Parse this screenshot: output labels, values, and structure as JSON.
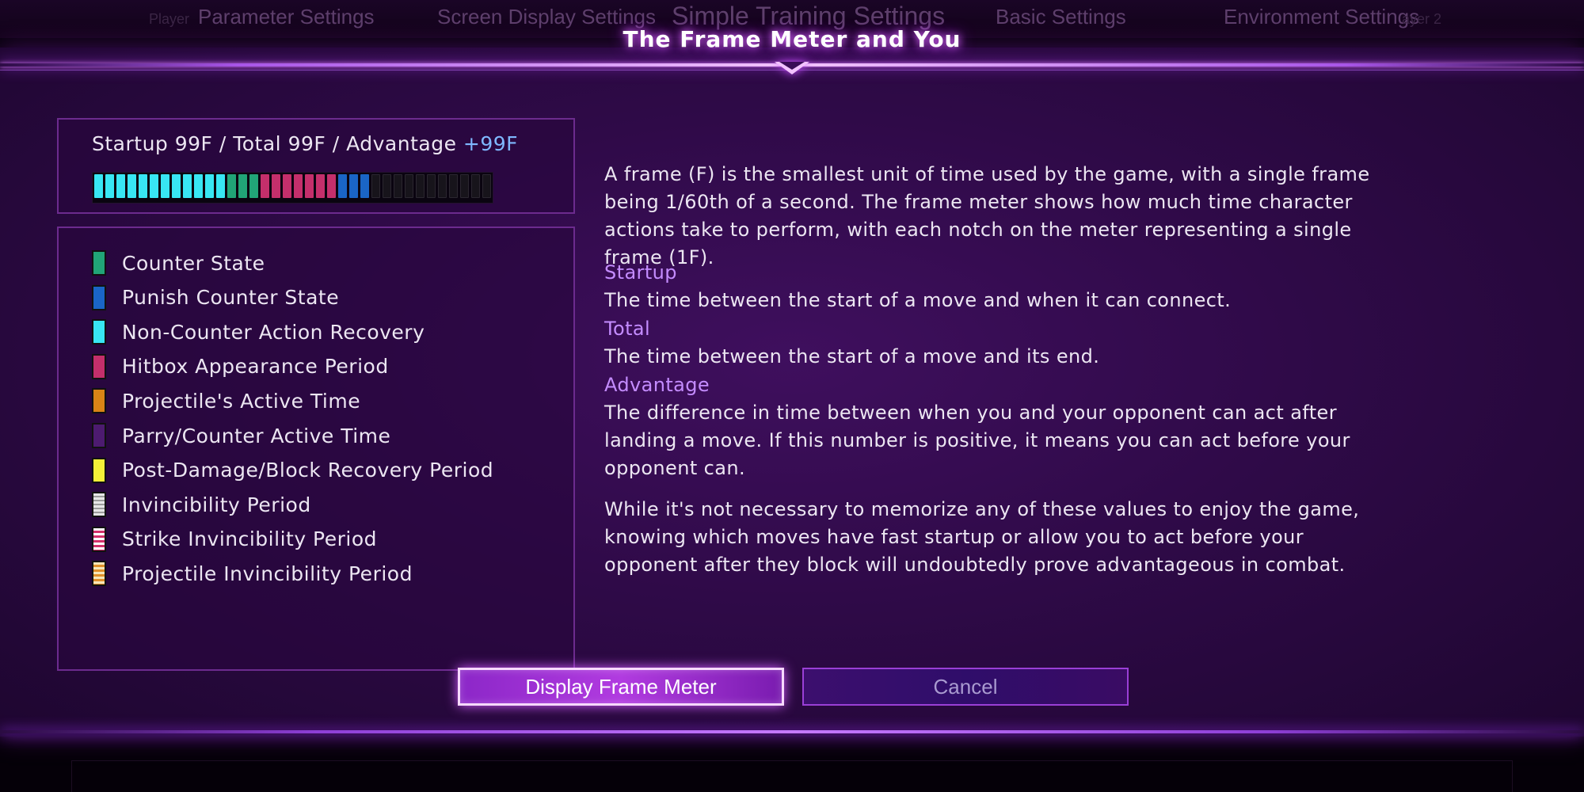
{
  "background_menu": {
    "hint_left": "Player",
    "tabs": [
      "Parameter Settings",
      "Screen Display Settings",
      "Simple Training Settings",
      "Basic Settings",
      "Environment Settings"
    ],
    "hint_right": "ayer 2"
  },
  "dialog": {
    "title": "The Frame Meter and You"
  },
  "summary": {
    "text": "Startup 99F / Total 99F / Advantage ",
    "advantage": "+99F",
    "meter_notches": [
      "cyan",
      "cyan",
      "cyan",
      "cyan",
      "cyan",
      "cyan",
      "cyan",
      "cyan",
      "cyan",
      "cyan",
      "cyan",
      "cyan",
      "green",
      "green",
      "green",
      "red",
      "red",
      "red",
      "red",
      "red",
      "red",
      "red",
      "blue",
      "blue",
      "blue",
      "empty",
      "empty",
      "empty",
      "empty",
      "empty",
      "empty",
      "empty",
      "empty",
      "empty",
      "empty",
      "empty"
    ]
  },
  "legend": [
    {
      "label": "Counter State",
      "swatch": "green"
    },
    {
      "label": "Punish Counter State",
      "swatch": "blue"
    },
    {
      "label": "Non-Counter Action Recovery",
      "swatch": "cyan"
    },
    {
      "label": "Hitbox Appearance Period",
      "swatch": "red"
    },
    {
      "label": "Projectile's Active Time",
      "swatch": "orange"
    },
    {
      "label": "Parry/Counter Active Time",
      "swatch": "purple"
    },
    {
      "label": "Post-Damage/Block Recovery Period",
      "swatch": "yellow"
    },
    {
      "label": "Invincibility Period",
      "swatch": "inv"
    },
    {
      "label": "Strike Invincibility Period",
      "swatch": "strike"
    },
    {
      "label": "Projectile Invincibility Period",
      "swatch": "proj"
    }
  ],
  "description": {
    "intro": "A frame (F) is the smallest unit of time used by the game, with a single frame being 1/60th of a second. The frame meter shows how much time character actions take to perform, with each notch on the meter representing a single frame (1F).",
    "startup_heading": "Startup",
    "startup_text": "The time between the start of a move and when it can connect.",
    "total_heading": "Total",
    "total_text": "The time between the start of a move and its end.",
    "advantage_heading": "Advantage",
    "advantage_text": "The difference in time between when you and your opponent can act after landing a move. If this number is positive, it means you can act before your opponent can.",
    "closing": "While it's not necessary to memorize any of these values to enjoy the game, knowing which moves have fast startup or allow you to act before your opponent after they block will undoubtedly prove advantageous in combat."
  },
  "buttons": {
    "primary": "Display Frame Meter",
    "secondary": "Cancel"
  },
  "colors": {
    "accent": "#b13bff",
    "heading": "#c48cff",
    "advantage_value": "#7fb8ff"
  }
}
